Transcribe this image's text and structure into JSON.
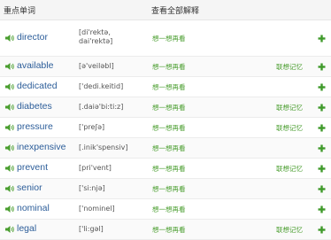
{
  "header": {
    "title": "重点单词",
    "view_all": "查看全部解释"
  },
  "rows": [
    {
      "word": "director",
      "phonetic_line1": "[di'rektə,",
      "phonetic_line2": "dai'rektə]",
      "think": "想一想再看",
      "memory": ""
    },
    {
      "word": "available",
      "phonetic_line1": "[ə'veiləbl]",
      "phonetic_line2": "",
      "think": "想一想再看",
      "memory": "联想记忆"
    },
    {
      "word": "dedicated",
      "phonetic_line1": "['dedi.keitid]",
      "phonetic_line2": "",
      "think": "想一想再看",
      "memory": ""
    },
    {
      "word": "diabetes",
      "phonetic_line1": "[.daiə'bi:ti:z]",
      "phonetic_line2": "",
      "think": "想一想再看",
      "memory": "联想记忆"
    },
    {
      "word": "pressure",
      "phonetic_line1": "['preʃə]",
      "phonetic_line2": "",
      "think": "想一想再看",
      "memory": "联想记忆"
    },
    {
      "word": "inexpensive",
      "phonetic_line1": "[.inik'spensiv]",
      "phonetic_line2": "",
      "think": "想一想再看",
      "memory": ""
    },
    {
      "word": "prevent",
      "phonetic_line1": "[pri'vent]",
      "phonetic_line2": "",
      "think": "想一想再看",
      "memory": "联想记忆"
    },
    {
      "word": "senior",
      "phonetic_line1": "['si:njə]",
      "phonetic_line2": "",
      "think": "想一想再看",
      "memory": ""
    },
    {
      "word": "nominal",
      "phonetic_line1": "['nominel]",
      "phonetic_line2": "",
      "think": "想一想再看",
      "memory": ""
    },
    {
      "word": "legal",
      "phonetic_line1": "['li:gəl]",
      "phonetic_line2": "",
      "think": "想一想再看",
      "memory": "联想记忆"
    }
  ],
  "icons": {
    "speaker": "speaker-icon",
    "add": "plus-icon"
  },
  "colors": {
    "word": "#2c5d99",
    "green": "#4a9e2f",
    "header_bg": "#f5f5f5"
  }
}
